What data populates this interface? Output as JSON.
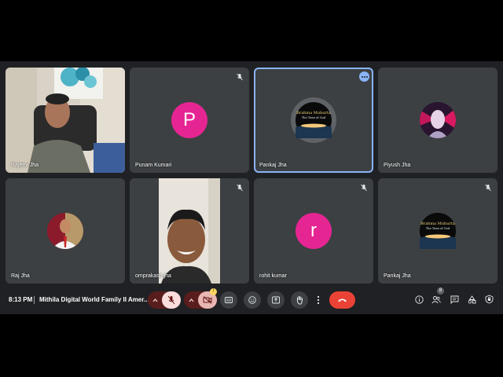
{
  "meeting": {
    "time": "8:13 PM",
    "title": "Mithila Digital World Family II Amer...",
    "participants_badge": "8",
    "warning_badge": "!"
  },
  "tiles": [
    {
      "name": "Rajeev Jha"
    },
    {
      "name": "Punam Kumari",
      "avatar_letter": "P"
    },
    {
      "name": "Pankaj Jha",
      "avatar_text_1": "Brahma Muhurta",
      "avatar_text_2": "The Time of God"
    },
    {
      "name": "Piyush Jha"
    },
    {
      "name": "Raj Jha"
    },
    {
      "name": "omprakash jha"
    },
    {
      "name": "rohit kumar",
      "avatar_letter": "r"
    },
    {
      "name": "Pankaj Jha",
      "avatar_text_1": "Brahma Muhurta",
      "avatar_text_2": "The Time of God"
    }
  ],
  "colors": {
    "tile_bg": "#3c4043",
    "active_outline": "#8ab4f8",
    "avatar_pink": "#e52592",
    "hangup_red": "#ea4335",
    "muted_bg": "#f9dedc"
  }
}
